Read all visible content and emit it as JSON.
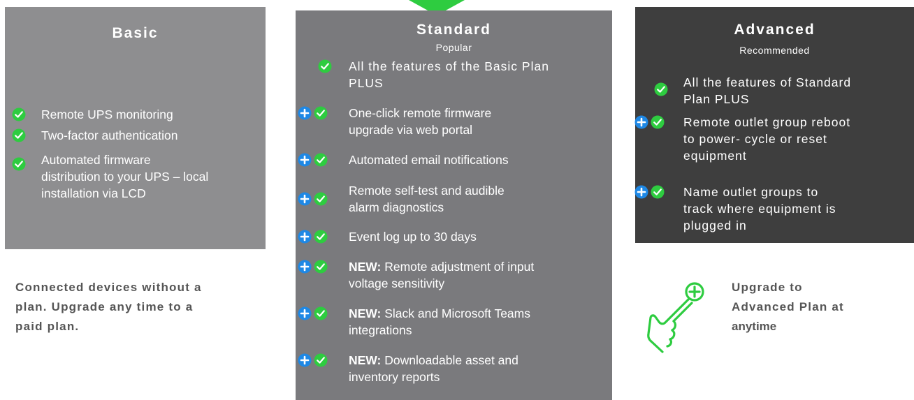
{
  "basic": {
    "title": "Basic",
    "features": [
      {
        "lines": [
          "Remote  UPS monitoring"
        ]
      },
      {
        "lines": [
          "Two-factor authentication"
        ]
      },
      {
        "lines": [
          "Automated firmware",
          "distribution to your UPS – local",
          "installation via LCD"
        ]
      }
    ],
    "note": [
      "Connected devices without a",
      "plan. Upgrade any time to a",
      "paid plan."
    ]
  },
  "standard": {
    "title": "Standard",
    "subtitle": "Popular",
    "features": [
      {
        "lines": [
          "All the features of the Basic Plan",
          "PLUS"
        ]
      },
      {
        "lines": [
          "One-click remote firmware",
          "upgrade via web portal"
        ]
      },
      {
        "lines": [
          "Automated email notifications"
        ]
      },
      {
        "lines": [
          "Remote self-test and audible",
          "alarm diagnostics"
        ]
      },
      {
        "lines": [
          "Event log up to 30 days"
        ]
      },
      {
        "tag": "NEW:",
        "lines": [
          " Remote adjustment of input",
          "voltage sensitivity"
        ]
      },
      {
        "tag": "NEW:",
        "lines": [
          " Slack and Microsoft Teams",
          "integrations"
        ]
      },
      {
        "tag": "NEW:",
        "lines": [
          " Downloadable asset and",
          "inventory reports"
        ]
      }
    ]
  },
  "advanced": {
    "title": "Advanced",
    "subtitle": "Recommended",
    "features": [
      {
        "lines": [
          "All the features of Standard",
          "Plan PLUS"
        ]
      },
      {
        "lines": [
          "Remote outlet group reboot",
          "to power- cycle or reset",
          "equipment"
        ]
      },
      {
        "lines": [
          "Name outlet groups to",
          "track where  equipment is",
          "plugged in"
        ]
      }
    ],
    "note": [
      "Upgrade to",
      "Advanced Plan at",
      "anytime"
    ]
  },
  "colors": {
    "check": "#2ecc40",
    "plus": "#1e88e5",
    "note": "#555555"
  }
}
